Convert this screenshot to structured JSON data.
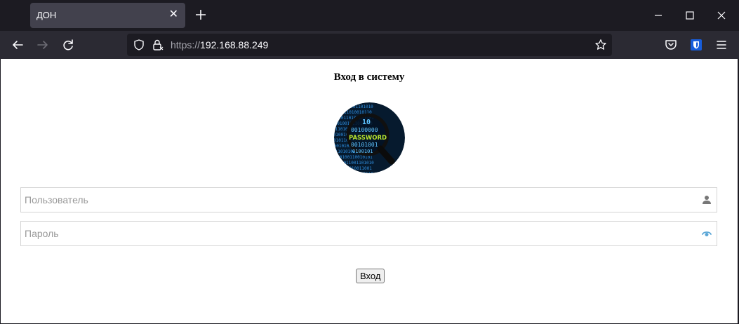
{
  "browser": {
    "tab_title": "ДОН",
    "url_protocol": "https://",
    "url_host": "192.168.88.249"
  },
  "page": {
    "title": "Вход в систему",
    "avatar_text": "PASSWORD",
    "username_placeholder": "Пользователь",
    "password_placeholder": "Пароль",
    "login_label": "Вход"
  },
  "colors": {
    "accent_eye": "#5aa6d6",
    "user_icon": "#777777"
  }
}
